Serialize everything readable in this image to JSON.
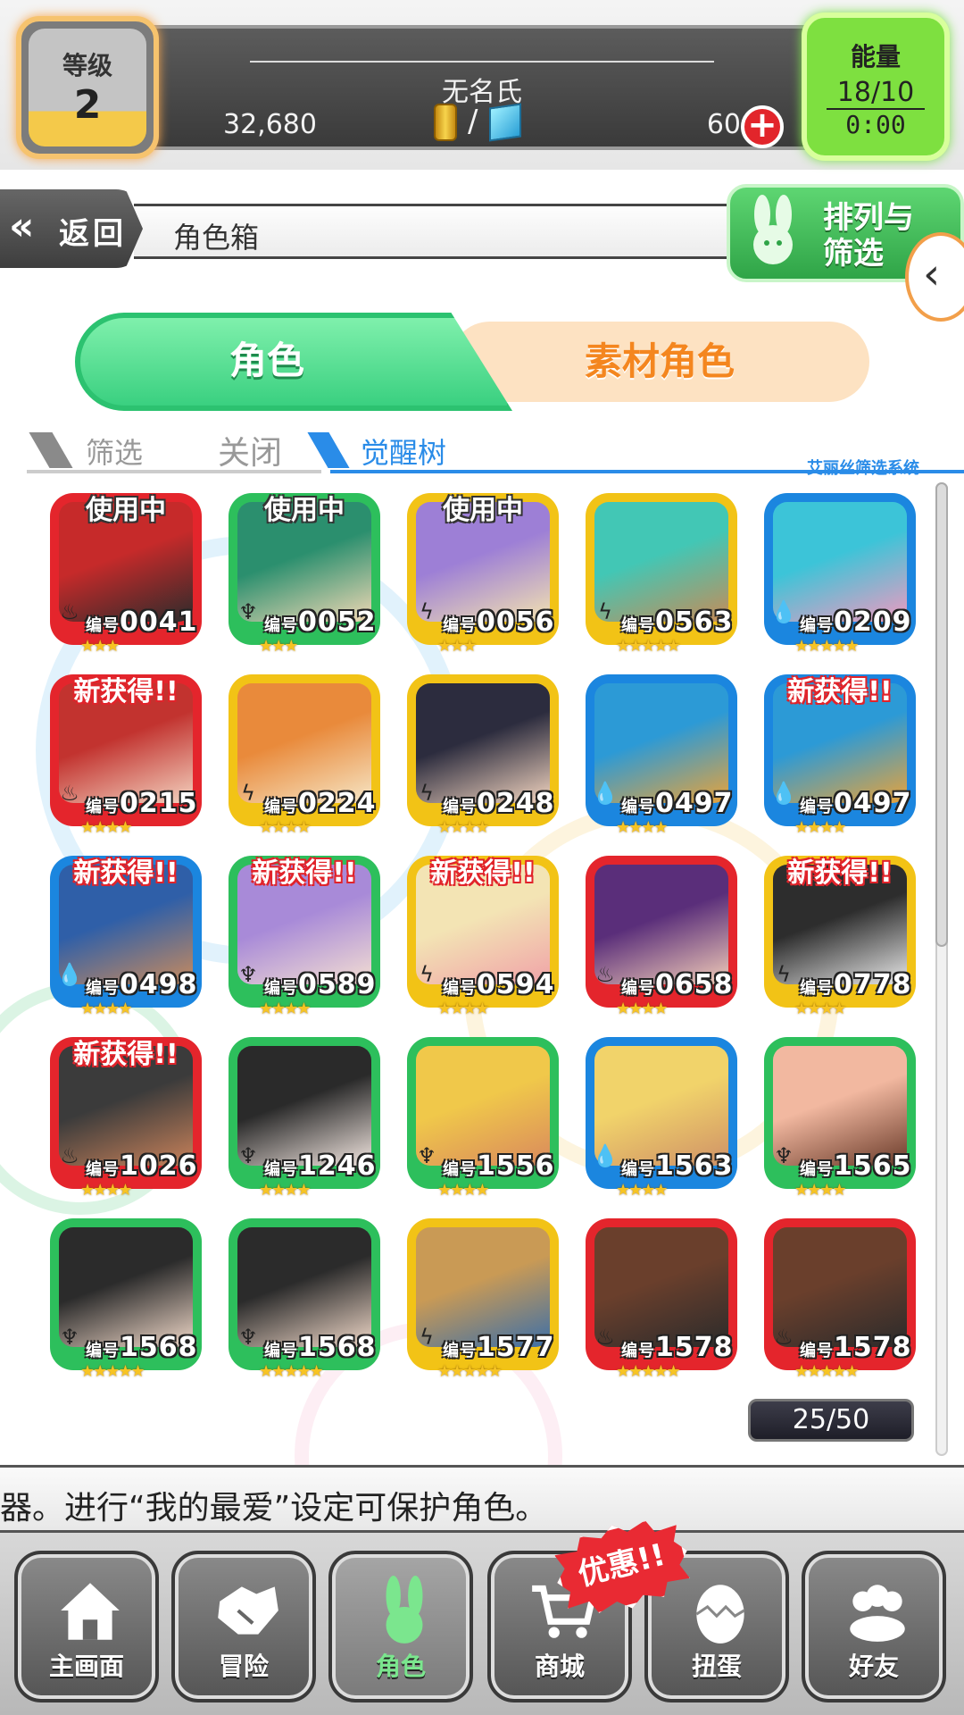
{
  "status": {
    "level_label": "等级",
    "level_value": "2",
    "player_name": "无名氏",
    "gold": "32,680",
    "currency_separator": "/",
    "gems": "60",
    "energy_label": "能量",
    "energy_value": "18/10",
    "energy_timer": "0:00"
  },
  "nav": {
    "back_label": "返回",
    "page_title": "角色箱",
    "sort_filter_label": "排列与筛选"
  },
  "tabs": {
    "characters": "角色",
    "materials": "素材角色"
  },
  "filter": {
    "filter_label": "筛选",
    "close_label": "关闭",
    "awaken_label": "觉醒树",
    "system_label": "艾丽丝筛选系统"
  },
  "tag_texts": {
    "in_use": "使用中",
    "new": "新获得!!"
  },
  "number_prefix": "编号",
  "cards": [
    {
      "id": "0041",
      "frame": "#e4252c",
      "element": "fire",
      "tag": "使用中",
      "stars": 3,
      "art": [
        "#c62a2a",
        "#2b2b2b"
      ]
    },
    {
      "id": "0052",
      "frame": "#2dbf5c",
      "element": "wood",
      "tag": "使用中",
      "stars": 3,
      "art": [
        "#2b8f6e",
        "#f2d9b5"
      ]
    },
    {
      "id": "0056",
      "frame": "#f2c316",
      "element": "light",
      "tag": "使用中",
      "stars": 3,
      "art": [
        "#9d7fd6",
        "#f4e3b0"
      ]
    },
    {
      "id": "0563",
      "frame": "#f2c316",
      "element": "light",
      "tag": "",
      "stars": 5,
      "art": [
        "#42c7b5",
        "#c78b57"
      ]
    },
    {
      "id": "0209",
      "frame": "#1b86df",
      "element": "water",
      "tag": "",
      "stars": 5,
      "art": [
        "#3cc4d8",
        "#f09ac0"
      ]
    },
    {
      "id": "0215",
      "frame": "#e4252c",
      "element": "fire",
      "tag": "新获得!!",
      "stars": 4,
      "art": [
        "#c2332f",
        "#f3d2bf"
      ]
    },
    {
      "id": "0224",
      "frame": "#f2c316",
      "element": "light",
      "tag": "",
      "stars": 4,
      "art": [
        "#e98a3b",
        "#f6e6c6"
      ]
    },
    {
      "id": "0248",
      "frame": "#f2c316",
      "element": "light",
      "tag": "",
      "stars": 4,
      "art": [
        "#2c2c3e",
        "#f3d5c0"
      ]
    },
    {
      "id": "0497",
      "frame": "#1b86df",
      "element": "water",
      "tag": "",
      "stars": 4,
      "art": [
        "#2c9ad6",
        "#e9a33a"
      ]
    },
    {
      "id": "0497",
      "frame": "#1b86df",
      "element": "water",
      "tag": "新获得!!",
      "stars": 4,
      "art": [
        "#2c9ad6",
        "#e9a33a"
      ]
    },
    {
      "id": "0498",
      "frame": "#1b86df",
      "element": "water",
      "tag": "新获得!!",
      "stars": 4,
      "art": [
        "#2f5fa8",
        "#c98b5d"
      ]
    },
    {
      "id": "0589",
      "frame": "#2dbf5c",
      "element": "wood",
      "tag": "新获得!!",
      "stars": 4,
      "art": [
        "#a88ad8",
        "#f4dfd2"
      ]
    },
    {
      "id": "0594",
      "frame": "#f2c316",
      "element": "light",
      "tag": "新获得!!",
      "stars": 4,
      "art": [
        "#f3e4b4",
        "#f0a2a8"
      ]
    },
    {
      "id": "0658",
      "frame": "#e4252c",
      "element": "fire",
      "tag": "",
      "stars": 4,
      "art": [
        "#5a2e7a",
        "#f2cdb8"
      ]
    },
    {
      "id": "0778",
      "frame": "#f2c316",
      "element": "light",
      "tag": "新获得!!",
      "stars": 4,
      "art": [
        "#2d2d2d",
        "#e8e8e8"
      ]
    },
    {
      "id": "1026",
      "frame": "#e4252c",
      "element": "fire",
      "tag": "新获得!!",
      "stars": 4,
      "art": [
        "#3b3b3b",
        "#c9825a"
      ]
    },
    {
      "id": "1246",
      "frame": "#2dbf5c",
      "element": "wood",
      "tag": "",
      "stars": 4,
      "art": [
        "#2a2a2a",
        "#f2e6e0"
      ]
    },
    {
      "id": "1556",
      "frame": "#2dbf5c",
      "element": "wood",
      "tag": "",
      "stars": 4,
      "art": [
        "#f0c84a",
        "#d9895d"
      ]
    },
    {
      "id": "1563",
      "frame": "#1b86df",
      "element": "water",
      "tag": "",
      "stars": 4,
      "art": [
        "#f1d36a",
        "#cf9167"
      ]
    },
    {
      "id": "1565",
      "frame": "#2dbf5c",
      "element": "wood",
      "tag": "",
      "stars": 4,
      "art": [
        "#f2b8a0",
        "#6a3b2a"
      ]
    },
    {
      "id": "1568",
      "frame": "#2dbf5c",
      "element": "wood",
      "tag": "",
      "stars": 5,
      "art": [
        "#2b2b2b",
        "#f0d8c8"
      ]
    },
    {
      "id": "1568",
      "frame": "#2dbf5c",
      "element": "wood",
      "tag": "",
      "stars": 5,
      "art": [
        "#2b2b2b",
        "#f0d8c8"
      ]
    },
    {
      "id": "1577",
      "frame": "#f2c316",
      "element": "light",
      "tag": "",
      "stars": 5,
      "art": [
        "#c99a55",
        "#3c6fa8"
      ]
    },
    {
      "id": "1578",
      "frame": "#e4252c",
      "element": "fire",
      "tag": "",
      "stars": 5,
      "art": [
        "#6a3f2c",
        "#2b2b2b"
      ]
    },
    {
      "id": "1578",
      "frame": "#e4252c",
      "element": "fire",
      "tag": "",
      "stars": 5,
      "art": [
        "#6a3f2c",
        "#2b2b2b"
      ]
    }
  ],
  "element_glyphs": {
    "fire": "♨",
    "wood": "♆",
    "light": "ϟ",
    "water": "💧"
  },
  "page_counter": "25/50",
  "ticker": "器。进行“我的最爱”设定可保护角色。",
  "promo_badge": "优惠!!",
  "bottom_nav": [
    {
      "label": "主画面",
      "icon": "home-icon"
    },
    {
      "label": "冒险",
      "icon": "handshake-icon"
    },
    {
      "label": "角色",
      "icon": "rabbit-icon",
      "active": true
    },
    {
      "label": "商城",
      "icon": "cart-icon"
    },
    {
      "label": "扭蛋",
      "icon": "egg-icon"
    },
    {
      "label": "好友",
      "icon": "friends-icon"
    }
  ]
}
